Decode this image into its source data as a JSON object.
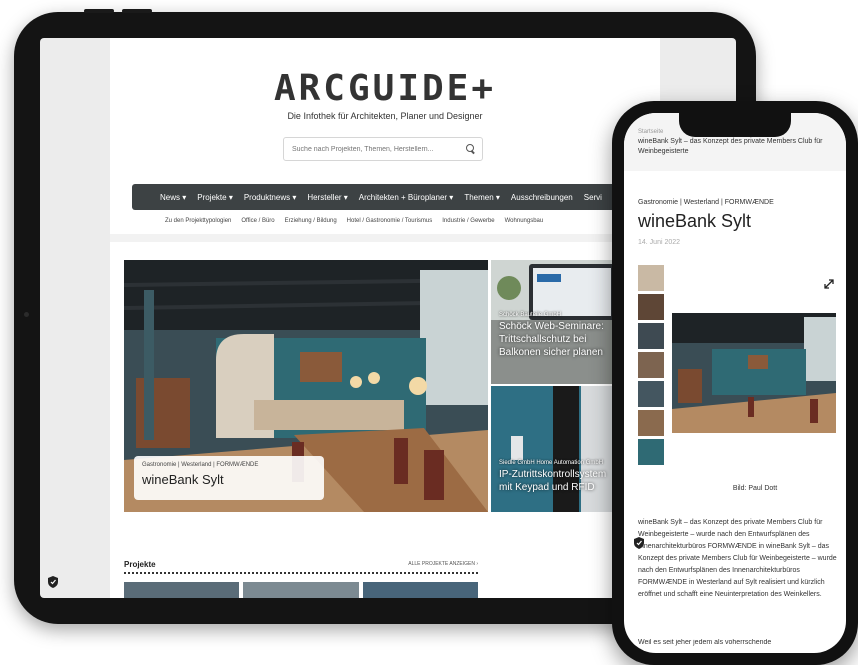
{
  "colors": {
    "nav_bg": "#3d4244",
    "bezel": "#141414",
    "accent_teal": "#2e6f84"
  },
  "tablet": {
    "logo": "ARCGUIDE+",
    "tagline": "Die Infothek für Architekten, Planer und Designer",
    "search": {
      "placeholder": "Suche nach Projekten, Themen, Herstellern..."
    },
    "nav": [
      "News ▾",
      "Projekte ▾",
      "Produktnews ▾",
      "Hersteller ▾",
      "Architekten + Büroplaner ▾",
      "Themen ▾",
      "Ausschreibungen",
      "Servi"
    ],
    "subnav": [
      "Zu den Projekttypologien",
      "Office / Büro",
      "Erziehung / Bildung",
      "Hotel / Gastronomie / Tourismus",
      "Industrie / Gewerbe",
      "Wohnungsbau"
    ],
    "hero": {
      "category": "Gastronomie | Westerland | FORMWÆNDE",
      "title": "wineBank Sylt"
    },
    "card1": {
      "category": "Schöck Bauteile GmbH",
      "title": "Schöck Web-Seminare: Trittschallschutz bei Balkonen sicher planen"
    },
    "card2": {
      "category": "Siedle GmbH Home Automation GmbH",
      "title": "IP-Zutrittskontrollsystem mit Keypad und RFID"
    },
    "projekte": {
      "label": "Projekte",
      "all": "ALLE PROJEKTE ANZEIGEN ›"
    }
  },
  "phone": {
    "breadcrumb": "Startseite",
    "breadcrumb_title": "wineBank Sylt – das Konzept des private Members Club für Weinbegeisterte",
    "category": "Gastronomie | Westerland | FORMWÆNDE",
    "title": "wineBank Sylt",
    "date": "14. Juni 2022",
    "credit": "Bild: Paul Dott",
    "paragraph": "wineBank Sylt – das Konzept des private Members Club für Weinbegeisterte – wurde nach den Entwurfsplänen des Innenarchitekturbüros FORMWÆNDE in wineBank Sylt – das Konzept des private Members Club für Weinbegeisterte – wurde nach den Entwurfsplänen des Innenarchitekturbüros FORMWÆNDE in Westerland auf Sylt realisiert und kürzlich eröffnet und schafft eine Neuinterpretation des Weinkellers.",
    "more": "Weil es seit jeher jedem als voherrschende"
  }
}
